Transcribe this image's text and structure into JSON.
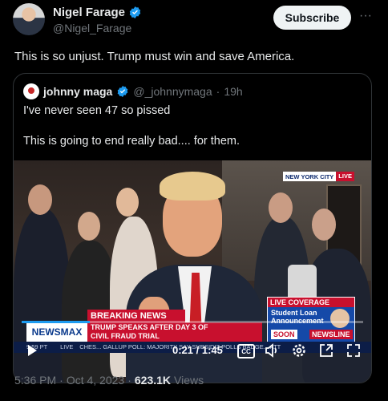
{
  "author": {
    "name": "Nigel Farage",
    "handle": "@Nigel_Farage"
  },
  "actions": {
    "subscribe_label": "Subscribe",
    "more_label": "···"
  },
  "tweet_text": "This is so unjust. Trump must win and save America.",
  "quoted": {
    "name": "johnny maga",
    "handle": "@_johnnymaga",
    "separator": "·",
    "age": "19h",
    "line1": "I've never seen 47 so pissed",
    "line2": "This is going to end really bad.... for them."
  },
  "video": {
    "badge_location": "NEW YORK CITY",
    "badge_live": "LIVE",
    "breaking_label": "BREAKING NEWS",
    "network": "NEWSMAX",
    "headline_line1": "TRUMP SPEAKS AFTER DAY 3 OF",
    "headline_line2": "CIVIL FRAUD TRIAL",
    "live_coverage_label": "LIVE COVERAGE",
    "live_coverage_text": "Student Loan Announcement",
    "soon_label": "SOON",
    "newsline_label": "NEWSLINE",
    "ticker_time": "9:59 PT",
    "ticker_live": "LIVE",
    "ticker_text": "CHES...      GALLUP POLL: MAJORITY SAY SUBSIDIZ POLLS BADGE... ATT",
    "time_display": "0:21 / 1:45",
    "progress_fraction": 0.2,
    "cc_label": "CC"
  },
  "meta": {
    "time": "5:36 PM",
    "separator": "·",
    "date": "Oct 4, 2023",
    "separator2": "·",
    "views_count": "623.1K",
    "views_label": "Views"
  },
  "colors": {
    "background": "#000000",
    "text_primary": "#e7e9ea",
    "text_secondary": "#71767b",
    "verified": "#1d9bf0",
    "newsmax_red": "#c8102e",
    "newsmax_blue": "#1549a8"
  },
  "icons": [
    "verified-badge-icon",
    "more-icon",
    "play-icon",
    "closed-captions-icon",
    "volume-icon",
    "settings-gear-icon",
    "picture-in-picture-icon",
    "fullscreen-icon"
  ]
}
